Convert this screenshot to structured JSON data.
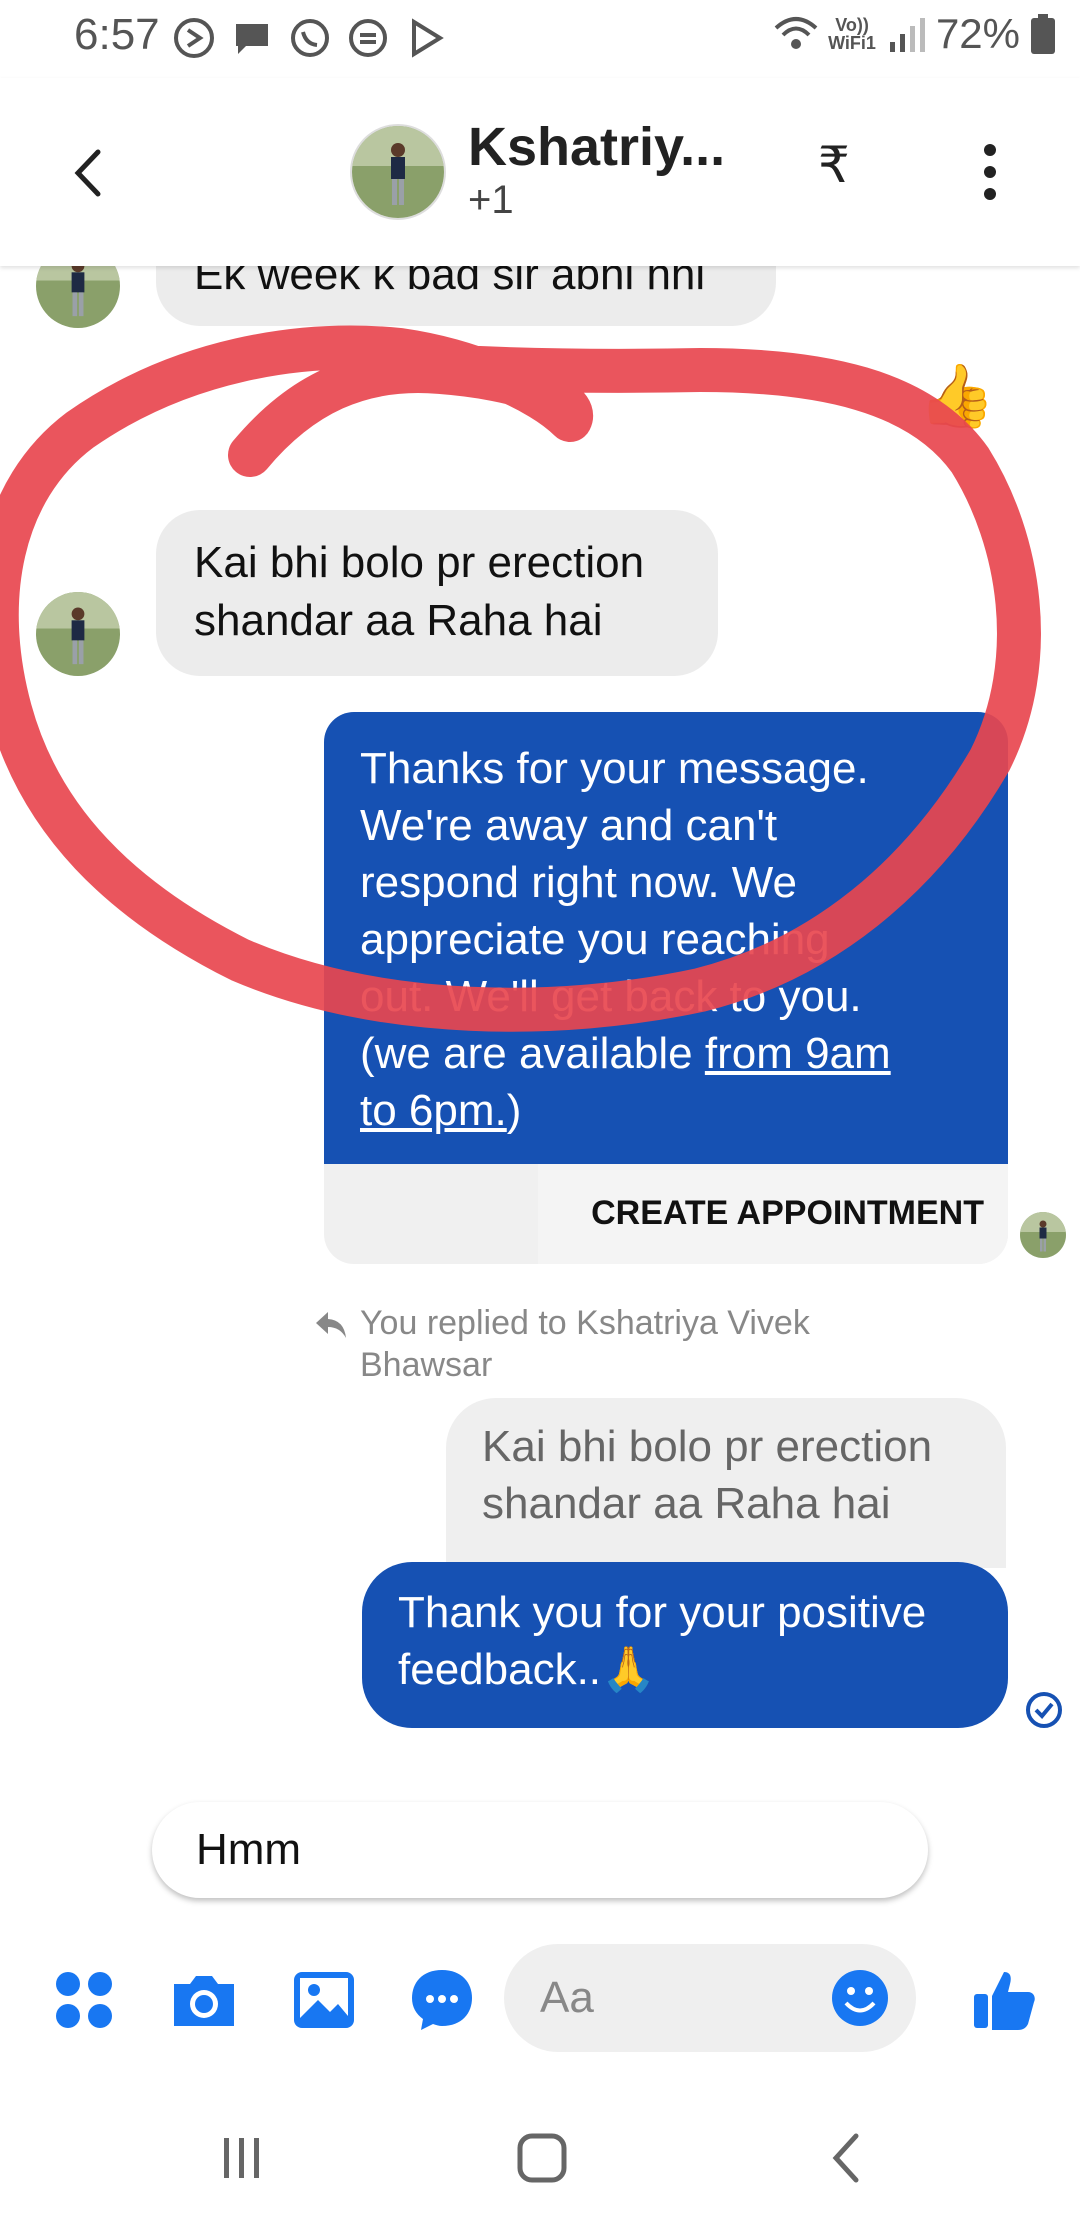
{
  "status_bar": {
    "time": "6:57",
    "network_line1": "Vo))",
    "network_line2": "WiFi1",
    "battery": "72%"
  },
  "header": {
    "title": "Kshatriy...",
    "subtitle": "+1",
    "currency_symbol": "₹"
  },
  "messages": {
    "prev_incoming": "Ek week k bad sir abhi hhi",
    "incoming_line1": "Kai bhi bolo pr erection",
    "incoming_line2": "shandar aa Raha hai",
    "away_line1": "Thanks for your message.",
    "away_line2": "We're away and can't",
    "away_line3": "respond right now. We",
    "away_line4": "appreciate you reaching",
    "away_line5": "out. We'll get back to you.",
    "away_line6_plain": "(we are available ",
    "away_line6_link": "from 9am",
    "away_line7_link": "to 6pm.",
    "away_line7_plain": ")",
    "create_appointment": "CREATE APPOINTMENT",
    "reply_note_line1": "You replied to Kshatriya Vivek",
    "reply_note_line2": "Bhawsar",
    "quoted_line1": "Kai bhi bolo pr erection",
    "quoted_line2": "shandar aa Raha hai",
    "reply_line1": "Thank you for your positive",
    "reply_line2": "feedback..🙏"
  },
  "quick_reply": "Hmm",
  "composer": {
    "placeholder": "Aa"
  },
  "colors": {
    "accent": "#1877f2",
    "outgoing_bubble": "#1651b3",
    "incoming_bubble": "#ececec",
    "scribble": "#e8474f"
  },
  "icons": [
    "menu-dots-icon",
    "camera-icon",
    "gallery-icon",
    "chat-bubble-icon",
    "emoji-icon",
    "thumbs-up-icon"
  ]
}
